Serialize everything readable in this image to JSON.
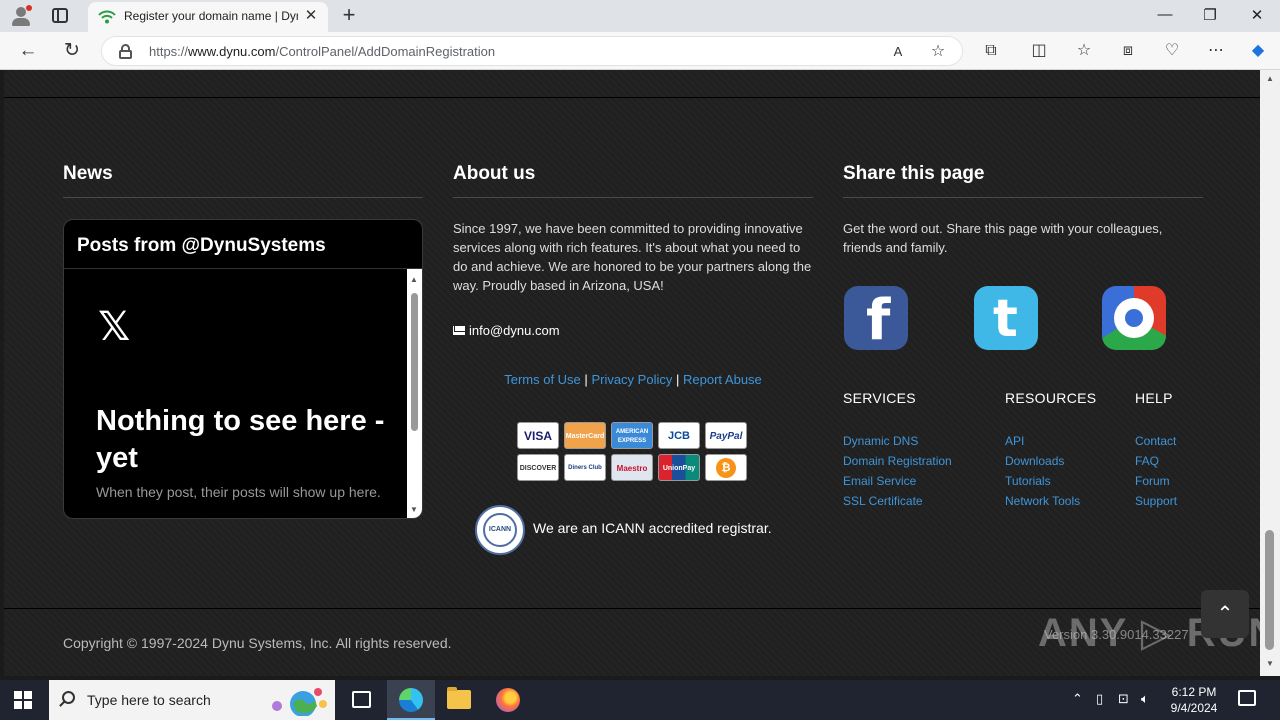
{
  "browser": {
    "tab_title": "Register your domain name | Dynu",
    "tab_close": "✕",
    "new_tab": "+",
    "url_domain": "www.dynu.com",
    "url_prefix": "https://",
    "url_path": "/ControlPanel/AddDomainRegistration",
    "window": {
      "minimize": "—",
      "maximize": "❐",
      "close": "✕"
    }
  },
  "news": {
    "heading": "News",
    "widget_title": "Posts from @DynuSystems",
    "x_logo": "𝕏",
    "empty_title": "Nothing to see here - yet",
    "empty_text": "When they post, their posts will show up here."
  },
  "about": {
    "heading": "About us",
    "text": "Since 1997, we have been committed to providing innovative services along with rich features. It's about what you need to do and achieve. We are honored to be your partners along the way. Proudly based in Arizona, USA!",
    "email": "info@dynu.com",
    "links": [
      "Terms of Use",
      "Privacy Policy",
      "Report Abuse"
    ],
    "separator": "|",
    "payment_methods": [
      "VISA",
      "MasterCard",
      "AMERICAN EXPRESS",
      "JCB",
      "PayPal",
      "DISCOVER",
      "Diners Club",
      "Maestro",
      "UnionPay",
      "₿"
    ],
    "icann_logo": "ICANN",
    "icann_text": "We are an ICANN accredited registrar."
  },
  "share": {
    "heading": "Share this page",
    "text": "Get the word out. Share this page with your colleagues, friends and family.",
    "icons": [
      "facebook-icon",
      "twitter-icon",
      "google-icon"
    ]
  },
  "footer_columns": [
    {
      "title": "SERVICES",
      "links": [
        "Dynamic DNS",
        "Domain Registration",
        "Email Service",
        "SSL Certificate"
      ]
    },
    {
      "title": "RESOURCES",
      "links": [
        "API",
        "Downloads",
        "Tutorials",
        "Network Tools"
      ]
    },
    {
      "title": "HELP",
      "links": [
        "Contact",
        "FAQ",
        "Forum",
        "Support"
      ]
    }
  ],
  "copyright": "Copyright © 1997-2024 Dynu Systems, Inc. All rights reserved.",
  "version": "Version 3.30.9014.33227",
  "watermark": "ANY ▷ RUN",
  "taskbar": {
    "search_placeholder": "Type here to search",
    "time": "6:12 PM",
    "date": "9/4/2024"
  },
  "colors": {
    "link": "#3f95d8",
    "page_bg": "#202020"
  }
}
